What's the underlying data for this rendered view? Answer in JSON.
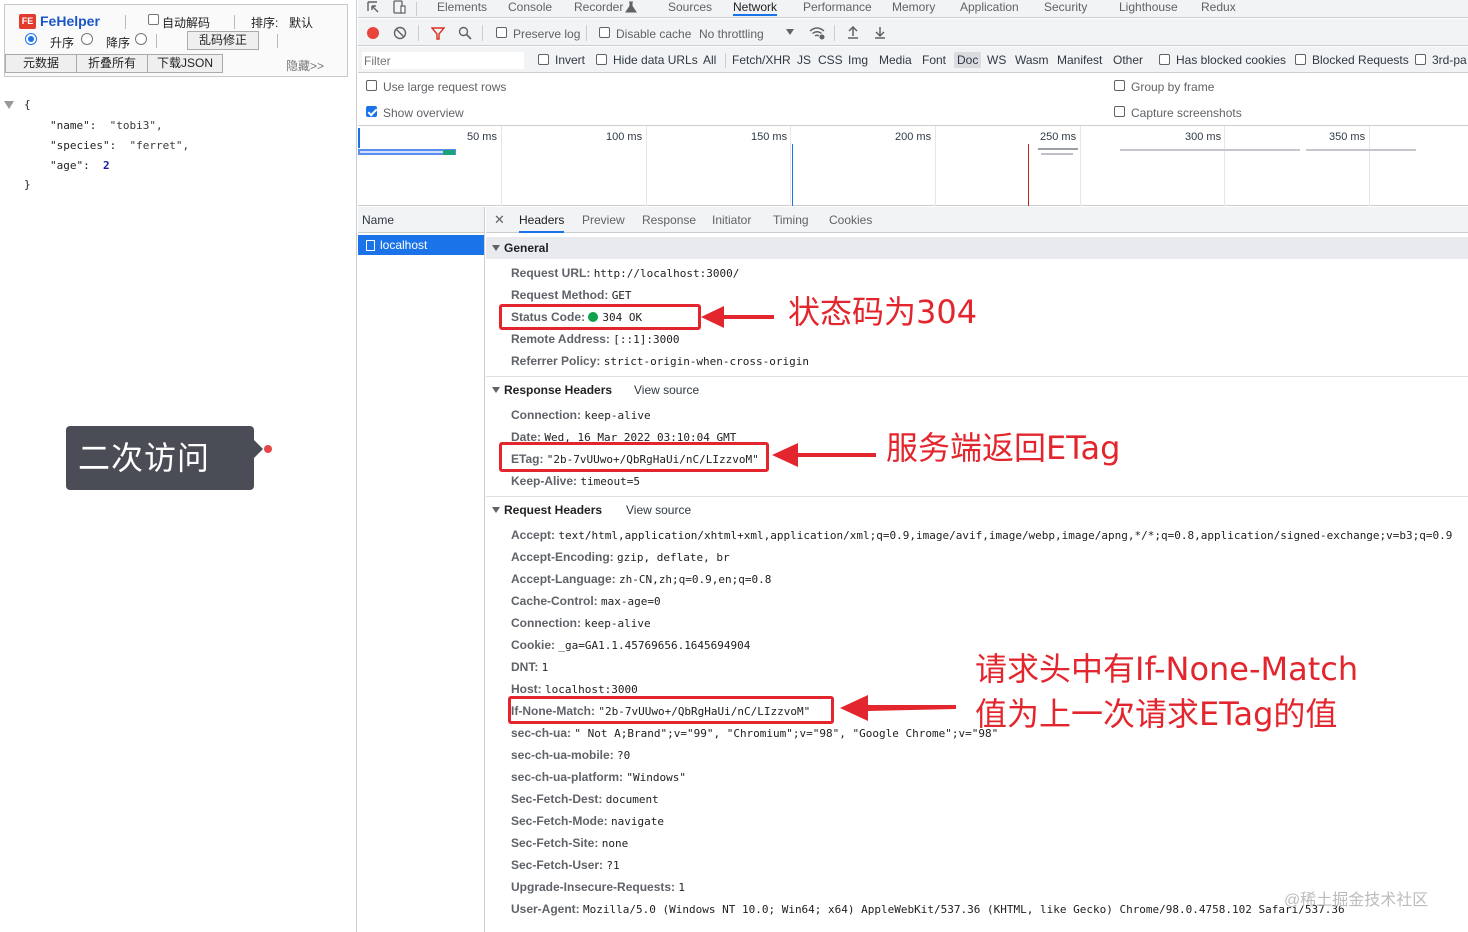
{
  "fehelper": {
    "logo_icon": "FE",
    "title": "FeHelper",
    "auto_decode_label": "自动解码",
    "sort_label": "排序:",
    "sort_default": "默认",
    "asc_label": "升序",
    "desc_label": "降序",
    "fix_garbled_button": "乱码修正",
    "raw_data_button": "元数据",
    "collapse_all_button": "折叠所有",
    "download_json_button": "下载JSON",
    "hide_link": "隐藏>>",
    "json": {
      "open_brace": "{",
      "lines": [
        {
          "key": "\"name\":",
          "value": "\"tobi3\",",
          "type": "string"
        },
        {
          "key": "\"species\":",
          "value": "\"ferret\",",
          "type": "string"
        },
        {
          "key": "\"age\":",
          "value": "2",
          "type": "number"
        }
      ],
      "close_brace": "}"
    }
  },
  "callout": {
    "second_visit": "二次访问"
  },
  "devtools": {
    "tabs": [
      "Elements",
      "Console",
      "Recorder",
      "Sources",
      "Network",
      "Performance",
      "Memory",
      "Application",
      "Security",
      "Lighthouse",
      "Redux"
    ],
    "active_tab": "Network",
    "toolbar": {
      "preserve_log": "Preserve log",
      "disable_cache": "Disable cache",
      "throttling": "No throttling"
    },
    "filter": {
      "placeholder": "Filter",
      "invert": "Invert",
      "hide_data_urls": "Hide data URLs",
      "types": [
        "All",
        "Fetch/XHR",
        "JS",
        "CSS",
        "Img",
        "Media",
        "Font",
        "Doc",
        "WS",
        "Wasm",
        "Manifest",
        "Other"
      ],
      "selected_type": "Doc",
      "has_blocked_cookies": "Has blocked cookies",
      "blocked_requests": "Blocked Requests",
      "third_party": "3rd-pa"
    },
    "options": {
      "large_rows": "Use large request rows",
      "show_overview": "Show overview",
      "group_by_frame": "Group by frame",
      "capture_screenshots": "Capture screenshots"
    },
    "overview_ticks": [
      "50 ms",
      "100 ms",
      "150 ms",
      "200 ms",
      "250 ms",
      "300 ms",
      "350 ms"
    ],
    "name_header": "Name",
    "request_name": "localhost",
    "detail_tabs": [
      "Headers",
      "Preview",
      "Response",
      "Initiator",
      "Timing",
      "Cookies"
    ],
    "active_detail_tab": "Headers",
    "general": {
      "title": "General",
      "rows": [
        {
          "k": "Request URL:",
          "v": "http://localhost:3000/"
        },
        {
          "k": "Request Method:",
          "v": "GET"
        },
        {
          "k": "Status Code:",
          "v": "304 OK"
        },
        {
          "k": "Remote Address:",
          "v": "[::1]:3000"
        },
        {
          "k": "Referrer Policy:",
          "v": "strict-origin-when-cross-origin"
        }
      ]
    },
    "response_headers": {
      "title": "Response Headers",
      "view_source": "View source",
      "rows": [
        {
          "k": "Connection:",
          "v": "keep-alive"
        },
        {
          "k": "Date:",
          "v": "Wed, 16 Mar 2022 03:10:04 GMT"
        },
        {
          "k": "ETag:",
          "v": "\"2b-7vUUwo+/QbRgHaUi/nC/LIzzvoM\""
        },
        {
          "k": "Keep-Alive:",
          "v": "timeout=5"
        }
      ]
    },
    "request_headers": {
      "title": "Request Headers",
      "view_source": "View source",
      "rows": [
        {
          "k": "Accept:",
          "v": "text/html,application/xhtml+xml,application/xml;q=0.9,image/avif,image/webp,image/apng,*/*;q=0.8,application/signed-exchange;v=b3;q=0.9"
        },
        {
          "k": "Accept-Encoding:",
          "v": "gzip, deflate, br"
        },
        {
          "k": "Accept-Language:",
          "v": "zh-CN,zh;q=0.9,en;q=0.8"
        },
        {
          "k": "Cache-Control:",
          "v": "max-age=0"
        },
        {
          "k": "Connection:",
          "v": "keep-alive"
        },
        {
          "k": "Cookie:",
          "v": "_ga=GA1.1.45769656.1645694904"
        },
        {
          "k": "DNT:",
          "v": "1"
        },
        {
          "k": "Host:",
          "v": "localhost:3000"
        },
        {
          "k": "If-None-Match:",
          "v": "\"2b-7vUUwo+/QbRgHaUi/nC/LIzzvoM\""
        },
        {
          "k": "sec-ch-ua:",
          "v": "\" Not A;Brand\";v=\"99\", \"Chromium\";v=\"98\", \"Google Chrome\";v=\"98\""
        },
        {
          "k": "sec-ch-ua-mobile:",
          "v": "?0"
        },
        {
          "k": "sec-ch-ua-platform:",
          "v": "\"Windows\""
        },
        {
          "k": "Sec-Fetch-Dest:",
          "v": "document"
        },
        {
          "k": "Sec-Fetch-Mode:",
          "v": "navigate"
        },
        {
          "k": "Sec-Fetch-Site:",
          "v": "none"
        },
        {
          "k": "Sec-Fetch-User:",
          "v": "?1"
        },
        {
          "k": "Upgrade-Insecure-Requests:",
          "v": "1"
        },
        {
          "k": "User-Agent:",
          "v": "Mozilla/5.0 (Windows NT 10.0; Win64; x64) AppleWebKit/537.36 (KHTML, like Gecko) Chrome/98.0.4758.102 Safari/537.36"
        }
      ]
    }
  },
  "annotations": {
    "status": "状态码为304",
    "etag": "服务端返回ETag",
    "if_none_match_line1": "请求头中有If-None-Match",
    "if_none_match_line2": "值为上一次请求ETag的值"
  },
  "watermark": "@稀土掘金技术社区",
  "colors": {
    "accent": "#1a73e8",
    "annotation_red": "#e3262d",
    "status_green": "#0fa14b",
    "callout_bg": "#4a4d55"
  }
}
